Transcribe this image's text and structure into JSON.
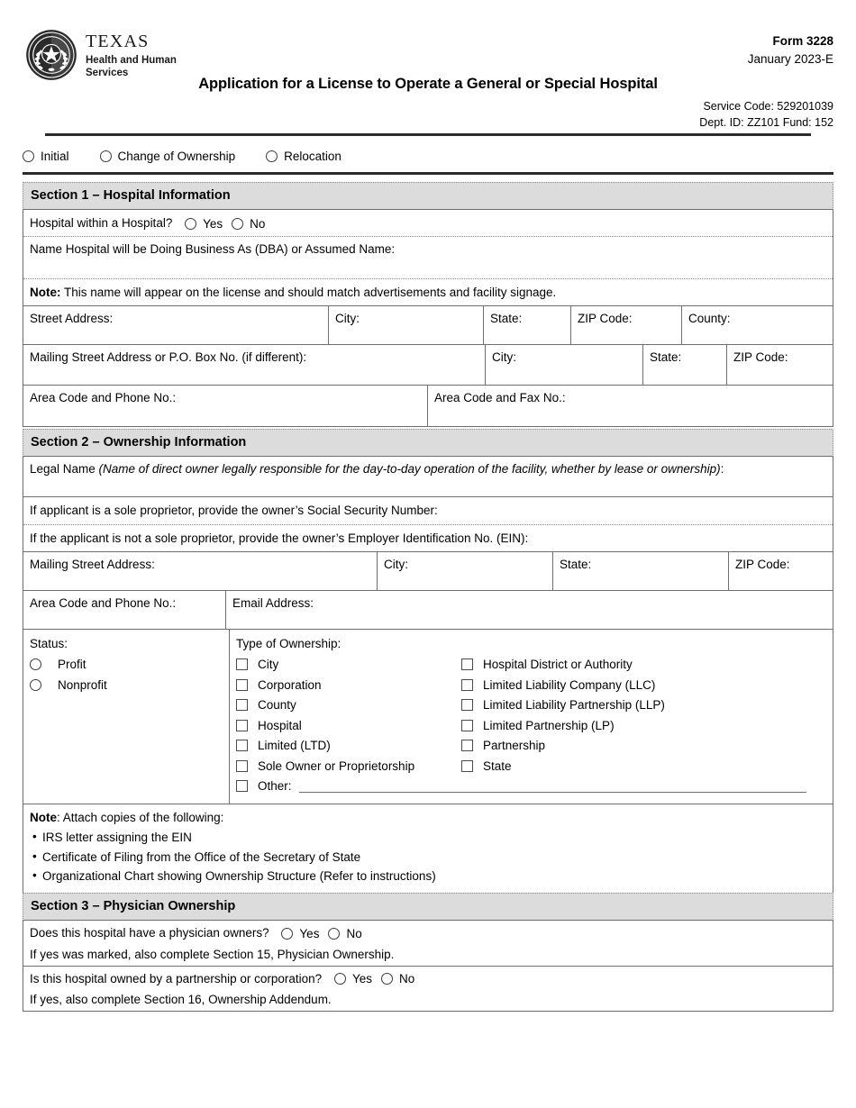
{
  "header": {
    "agency_name": "TEXAS",
    "agency_sub_line1": "Health and Human",
    "agency_sub_line2": "Services",
    "form_number": "Form 3228",
    "form_date": "January 2023-E",
    "title": "Application for a License to Operate a General or Special Hospital",
    "service_code": "Service Code: 529201039",
    "dept_id": "Dept. ID: ZZ101 Fund: 152"
  },
  "application_type": {
    "options": [
      {
        "label": "Initial"
      },
      {
        "label": "Change of Ownership"
      },
      {
        "label": "Relocation"
      }
    ]
  },
  "section1": {
    "title": "Section 1 – Hospital Information",
    "hwh_question": "Hospital within a Hospital?",
    "yes_label": "Yes",
    "no_label": "No",
    "dba_label": "Name Hospital will be Doing Business As (DBA) or Assumed Name:",
    "note_bold": "Note:",
    "note_text": " This name will appear on the license and should match advertisements and facility signage.",
    "street_address": "Street Address:",
    "city": "City:",
    "state": "State:",
    "zip": "ZIP Code:",
    "county": "County:",
    "mailing_address": "Mailing Street Address or P.O. Box No. (if different):",
    "mail_city": "City:",
    "mail_state": "State:",
    "mail_zip": "ZIP Code:",
    "phone": "Area Code and Phone No.:",
    "fax": "Area Code and Fax No.:"
  },
  "section2": {
    "title": "Section 2 – Ownership Information",
    "legal_name_label": "Legal Name ",
    "legal_name_italic": "(Name of direct owner legally responsible for the day-to-day operation of the facility, whether by lease or ownership)",
    "legal_name_colon": ":",
    "ssn_label": "If applicant is a sole proprietor, provide the owner’s Social Security Number:",
    "ein_label": "If the applicant is not a sole proprietor, provide the owner’s Employer Identification No. (EIN):",
    "mailing_address": "Mailing Street Address:",
    "city": "City:",
    "state": "State:",
    "zip": "ZIP Code:",
    "phone": "Area Code and Phone No.:",
    "email": "Email Address:",
    "status_label": "Status:",
    "status_options": [
      {
        "label": "Profit"
      },
      {
        "label": "Nonprofit"
      }
    ],
    "ownership_label": "Type of Ownership:",
    "ownership_left": [
      {
        "label": "City"
      },
      {
        "label": "Corporation"
      },
      {
        "label": "County"
      },
      {
        "label": "Hospital"
      },
      {
        "label": "Limited (LTD)"
      },
      {
        "label": "Sole Owner or Proprietorship"
      }
    ],
    "ownership_right": [
      {
        "label": "Hospital District or Authority"
      },
      {
        "label": "Limited Liability Company (LLC)"
      },
      {
        "label": "Limited Liability Partnership (LLP)"
      },
      {
        "label": "Limited Partnership (LP)"
      },
      {
        "label": "Partnership"
      },
      {
        "label": "State"
      }
    ],
    "other_label": "Other:",
    "note_bold": "Note",
    "note_text": ": Attach copies of the following:",
    "note_items": [
      "IRS letter assigning the EIN",
      "Certificate of Filing from the Office of the Secretary of State",
      "Organizational Chart showing Ownership Structure (Refer to instructions)"
    ]
  },
  "section3": {
    "title": "Section 3 – Physician Ownership",
    "q1": "Does this hospital have a physician owners?",
    "q1_sub": "If yes was marked, also complete Section 15, Physician Ownership.",
    "q2": "Is this hospital owned by a partnership or corporation?",
    "q2_sub": "If yes, also complete Section 16, Ownership Addendum.",
    "yes_label": "Yes",
    "no_label": "No"
  },
  "colors": {
    "section_header_bg": "#dcdcdc",
    "border": "#6e6e6e",
    "rule": "#2b2b2b"
  }
}
